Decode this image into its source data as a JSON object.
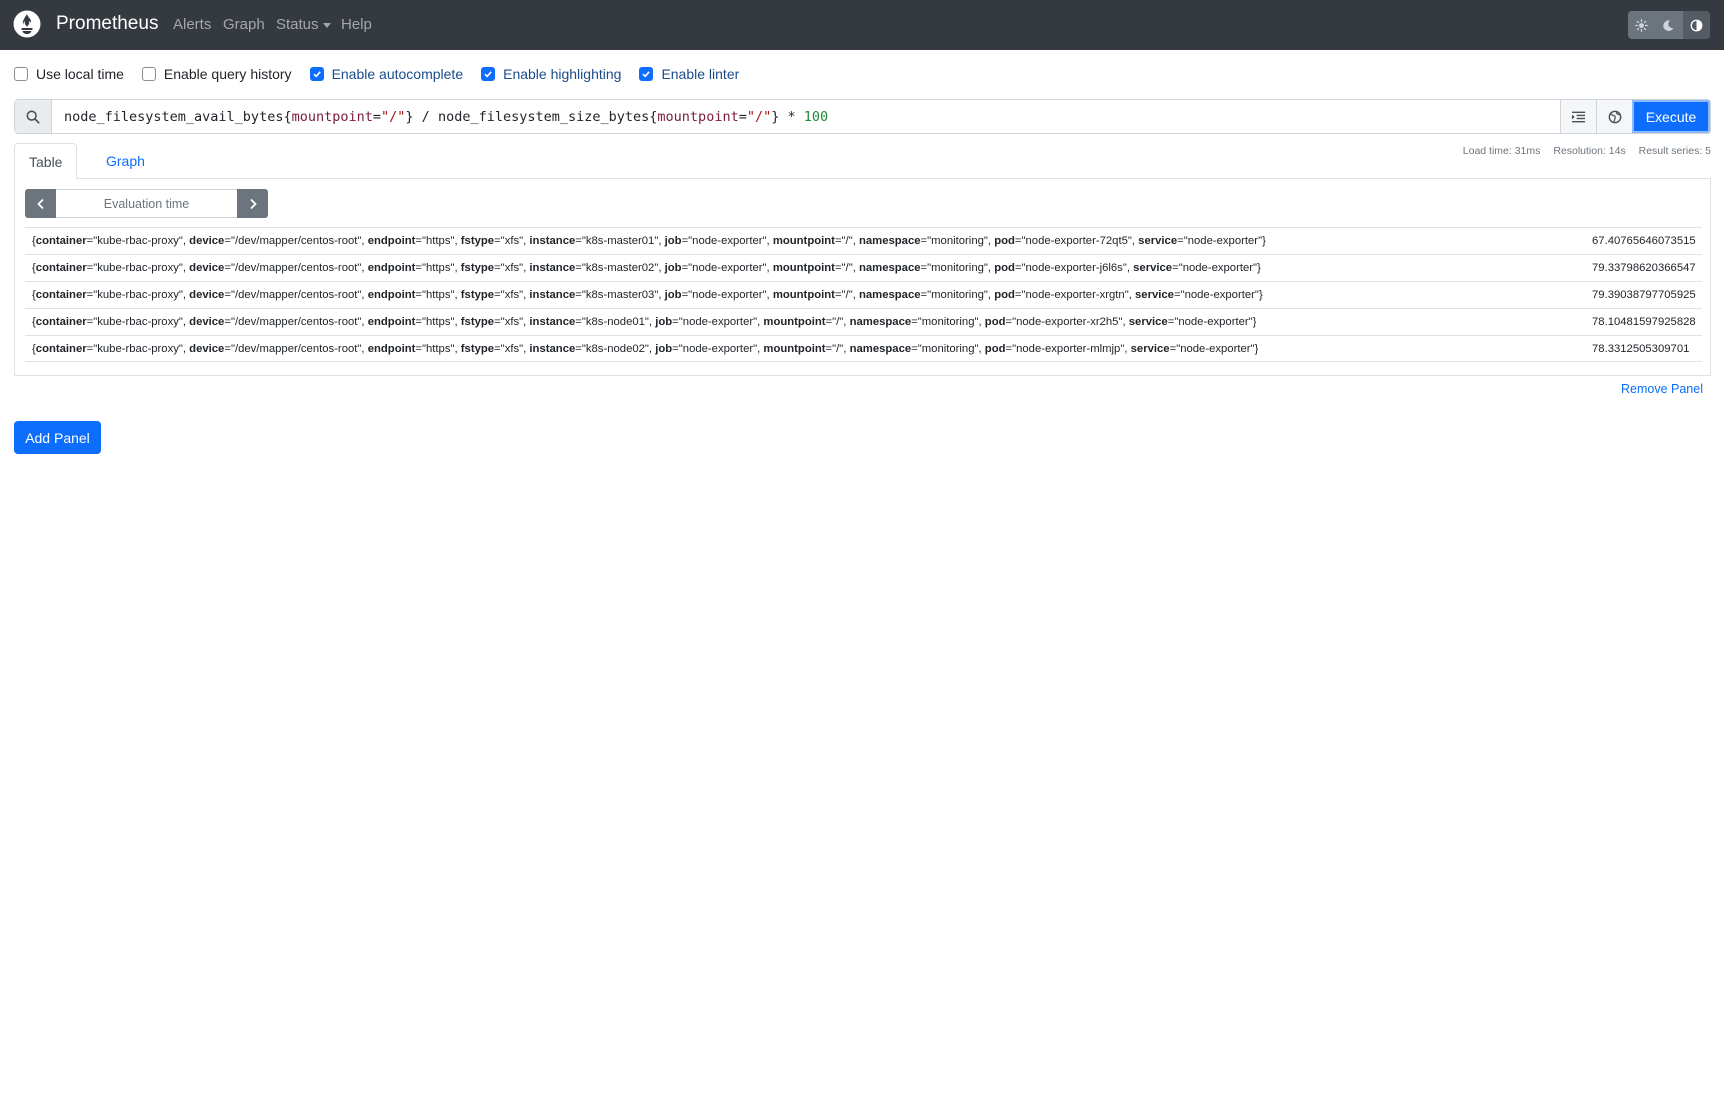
{
  "navbar": {
    "brand": "Prometheus",
    "links": [
      {
        "label": "Alerts"
      },
      {
        "label": "Graph"
      },
      {
        "label": "Status"
      },
      {
        "label": "Help"
      }
    ]
  },
  "options": [
    {
      "label": "Use local time",
      "checked": false
    },
    {
      "label": "Enable query history",
      "checked": false
    },
    {
      "label": "Enable autocomplete",
      "checked": true
    },
    {
      "label": "Enable highlighting",
      "checked": true
    },
    {
      "label": "Enable linter",
      "checked": true
    }
  ],
  "query": {
    "metric1": "node_filesystem_avail_bytes",
    "label1": "mountpoint",
    "value1": "\"/\"",
    "operator": "/",
    "metric2": "node_filesystem_size_bytes",
    "label2": "mountpoint",
    "value2": "\"/\"",
    "operator2": "*",
    "number": "100",
    "execute_label": "Execute"
  },
  "stats": {
    "load_time": "Load time: 31ms",
    "resolution": "Resolution: 14s",
    "result_series": "Result series: 5"
  },
  "tabs": [
    {
      "label": "Table",
      "active": true
    },
    {
      "label": "Graph",
      "active": false
    }
  ],
  "eval_time_placeholder": "Evaluation time",
  "results": [
    {
      "container": "kube-rbac-proxy",
      "device": "/dev/mapper/centos-root",
      "endpoint": "https",
      "fstype": "xfs",
      "instance": "k8s-master01",
      "job": "node-exporter",
      "mountpoint": "/",
      "namespace": "monitoring",
      "pod": "node-exporter-72qt5",
      "service": "node-exporter",
      "value": "67.40765646073515"
    },
    {
      "container": "kube-rbac-proxy",
      "device": "/dev/mapper/centos-root",
      "endpoint": "https",
      "fstype": "xfs",
      "instance": "k8s-master02",
      "job": "node-exporter",
      "mountpoint": "/",
      "namespace": "monitoring",
      "pod": "node-exporter-j6l6s",
      "service": "node-exporter",
      "value": "79.33798620366547"
    },
    {
      "container": "kube-rbac-proxy",
      "device": "/dev/mapper/centos-root",
      "endpoint": "https",
      "fstype": "xfs",
      "instance": "k8s-master03",
      "job": "node-exporter",
      "mountpoint": "/",
      "namespace": "monitoring",
      "pod": "node-exporter-xrgtn",
      "service": "node-exporter",
      "value": "79.39038797705925"
    },
    {
      "container": "kube-rbac-proxy",
      "device": "/dev/mapper/centos-root",
      "endpoint": "https",
      "fstype": "xfs",
      "instance": "k8s-node01",
      "job": "node-exporter",
      "mountpoint": "/",
      "namespace": "monitoring",
      "pod": "node-exporter-xr2h5",
      "service": "node-exporter",
      "value": "78.10481597925828"
    },
    {
      "container": "kube-rbac-proxy",
      "device": "/dev/mapper/centos-root",
      "endpoint": "https",
      "fstype": "xfs",
      "instance": "k8s-node02",
      "job": "node-exporter",
      "mountpoint": "/",
      "namespace": "monitoring",
      "pod": "node-exporter-mlmjp",
      "service": "node-exporter",
      "value": "78.3312505309701"
    }
  ],
  "remove_panel_label": "Remove Panel",
  "add_panel_label": "Add Panel",
  "colors": {
    "navbar": "#343a40",
    "primary": "#0d6efd",
    "secondary": "#6c757d"
  },
  "icons": {
    "brand": "prometheus-flame-icon",
    "search": "search-icon",
    "format": "format-indent-icon",
    "metrics": "globe-icon",
    "prev": "chevron-left-icon",
    "next": "chevron-right-icon",
    "theme_light": "sun-icon",
    "theme_dark": "moon-icon",
    "theme_auto": "half-circle-icon"
  }
}
